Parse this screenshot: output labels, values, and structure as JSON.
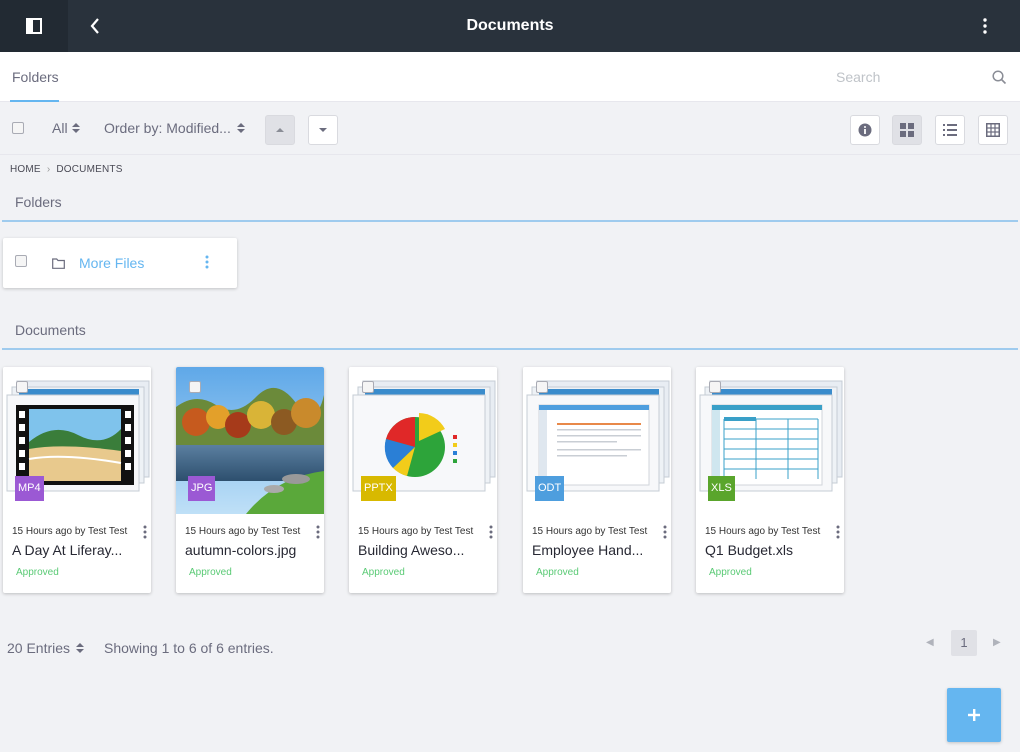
{
  "header": {
    "title": "Documents"
  },
  "nav": {
    "tab_label": "Folders",
    "search_placeholder": "Search"
  },
  "toolbar": {
    "filter_label": "All",
    "order_label": "Order by: Modified..."
  },
  "breadcrumb": [
    "HOME",
    "DOCUMENTS"
  ],
  "sections": {
    "folders_title": "Folders",
    "documents_title": "Documents"
  },
  "folders": [
    {
      "name": "More Files"
    }
  ],
  "documents": [
    {
      "badge": "MP4",
      "badge_color": "#9b59d4",
      "meta": "15 Hours ago by Test Test",
      "name": "A Day At Liferay...",
      "status": "Approved",
      "thumb": "video-icon"
    },
    {
      "badge": "JPG",
      "badge_color": "#9b59d4",
      "meta": "15 Hours ago by Test Test",
      "name": "autumn-colors.jpg",
      "status": "Approved",
      "thumb": "photo"
    },
    {
      "badge": "PPTX",
      "badge_color": "#d8b900",
      "meta": "15 Hours ago by Test Test",
      "name": "Building Aweso...",
      "status": "Approved",
      "thumb": "chart-icon"
    },
    {
      "badge": "ODT",
      "badge_color": "#4e9ede",
      "meta": "15 Hours ago by Test Test",
      "name": "Employee Hand...",
      "status": "Approved",
      "thumb": "document-icon"
    },
    {
      "badge": "XLS",
      "badge_color": "#5aa52c",
      "meta": "15 Hours ago by Test Test",
      "name": "Q1 Budget.xls",
      "status": "Approved",
      "thumb": "spreadsheet-icon"
    }
  ],
  "footer": {
    "entries_label": "20 Entries",
    "showing": "Showing 1 to 6 of 6 entries.",
    "current_page": "1"
  },
  "colors": {
    "topbar": "#29323c",
    "accent": "#65b6f0",
    "approved": "#5aca75"
  }
}
